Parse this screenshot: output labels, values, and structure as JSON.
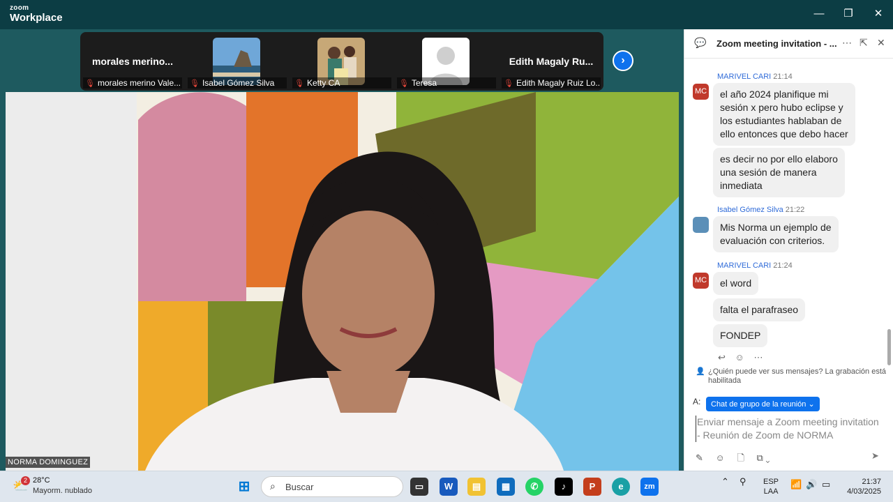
{
  "app": {
    "logo_line1": "zoom",
    "logo_line2": "Workplace"
  },
  "participants": [
    {
      "big": "morales  merino...",
      "name": "morales merino Vale..."
    },
    {
      "big": "",
      "name": "Isabel Gómez Silva"
    },
    {
      "big": "",
      "name": "Ketty CA"
    },
    {
      "big": "",
      "name": "Teresa"
    },
    {
      "big": "Edith  Magaly  Ru...",
      "name": "Edith Magaly Ruiz Lo..."
    }
  ],
  "speaker": {
    "label": "NORMA DOMINGUEZ"
  },
  "chat": {
    "title": "Zoom meeting invitation - ...",
    "messages": [
      {
        "sender": "MARIVEL CARI",
        "time": "21:14",
        "avatar": "MC",
        "lines": [
          "el año 2024 planifique mi",
          "sesión  x pero  hubo eclipse y",
          "los estudiantes  hablaban de",
          "ello entonces que debo hacer"
        ]
      },
      {
        "sender": "",
        "time": "",
        "avatar": "",
        "lines": [
          "es decir no por ello  elaboro",
          "una sesión de manera",
          "inmediata"
        ]
      },
      {
        "sender": "Isabel Gómez Silva",
        "time": "21:22",
        "avatar": "",
        "lines": [
          "Mis Norma  un ejemplo de",
          "evaluación con criterios."
        ]
      },
      {
        "sender": "MARIVEL CARI",
        "time": "21:24",
        "avatar": "MC",
        "lines": [
          "el word"
        ]
      },
      {
        "sender": "",
        "time": "",
        "avatar": "",
        "lines": [
          "falta el parafraseo"
        ]
      },
      {
        "sender": "",
        "time": "",
        "avatar": "",
        "lines": [
          "FONDEP"
        ]
      }
    ],
    "notice": "¿Quién puede ver sus mensajes? La grabación está habilitada",
    "to_label": "A:",
    "to_value": "Chat de grupo de la reunión",
    "input_placeholder_1": "Enviar mensaje a Zoom meeting invitation",
    "input_placeholder_2": "- Reunión de Zoom de NORMA"
  },
  "taskbar": {
    "weather_badge": "2",
    "temp": "28°C",
    "weather_desc": "Mayorm. nublado",
    "search_label": "Buscar",
    "lang1": "ESP",
    "lang2": "LAA",
    "time": "21:37",
    "date": "4/03/2025"
  },
  "colors": {
    "accent": "#0e72ed",
    "titlebar": "#0c3d44",
    "avatar_mc": "#c0392b"
  }
}
